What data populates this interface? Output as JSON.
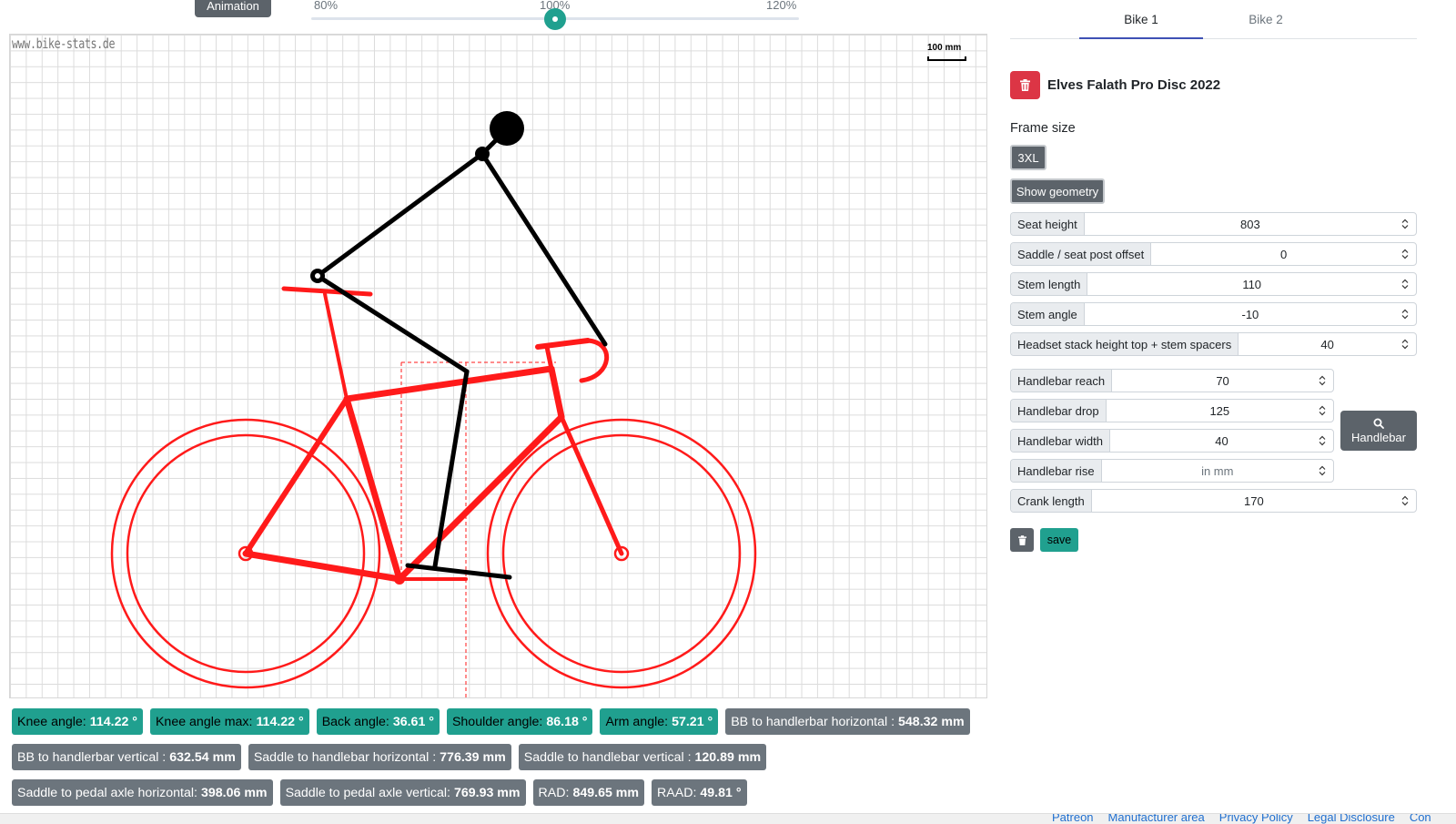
{
  "toolbar": {
    "animation_label": "Animation",
    "slider_min_label": "80%",
    "slider_value_label": "100%",
    "slider_max_label": "120%",
    "slider_value": 100
  },
  "canvas": {
    "watermark": "www.bike-stats.de",
    "scale_label": "100 mm"
  },
  "measurements": [
    [
      {
        "label": "Knee angle:",
        "value": "114.22 °",
        "color": "teal"
      },
      {
        "label": "Knee angle max:",
        "value": "114.22 °",
        "color": "teal"
      },
      {
        "label": "Back angle:",
        "value": "36.61 °",
        "color": "teal"
      },
      {
        "label": "Shoulder angle:",
        "value": "86.18 °",
        "color": "teal"
      },
      {
        "label": "Arm angle:",
        "value": "57.21 °",
        "color": "teal"
      },
      {
        "label": "BB to handlerbar horizontal :",
        "value": "548.32 mm",
        "color": "gray"
      }
    ],
    [
      {
        "label": "BB to handlerbar vertical :",
        "value": "632.54 mm",
        "color": "gray"
      },
      {
        "label": "Saddle to handlebar horizontal :",
        "value": "776.39 mm",
        "color": "gray"
      },
      {
        "label": "Saddle to handlebar vertical :",
        "value": "120.89 mm",
        "color": "gray"
      }
    ],
    [
      {
        "label": "Saddle to pedal axle horizontal:",
        "value": "398.06 mm",
        "color": "gray"
      },
      {
        "label": "Saddle to pedal axle vertical:",
        "value": "769.93 mm",
        "color": "gray"
      },
      {
        "label": "RAD:",
        "value": "849.65 mm",
        "color": "gray"
      },
      {
        "label": "RAAD:",
        "value": "49.81 °",
        "color": "gray"
      }
    ]
  ],
  "tabs": [
    {
      "label": "Bike 1",
      "active": true
    },
    {
      "label": "Bike 2",
      "active": false
    }
  ],
  "bike": {
    "name": "Elves Falath Pro Disc 2022",
    "frame_size_label": "Frame size",
    "frame_size": "3XL",
    "show_geometry_label": "Show geometry"
  },
  "fields": {
    "seat_height": {
      "label": "Seat height",
      "value": "803"
    },
    "saddle_offset": {
      "label": "Saddle / seat post offset",
      "value": "0"
    },
    "stem_length": {
      "label": "Stem length",
      "value": "110"
    },
    "stem_angle": {
      "label": "Stem angle",
      "value": "-10"
    },
    "headset_stack": {
      "label": "Headset stack height top + stem spacers",
      "value": "40"
    },
    "handlebar_reach": {
      "label": "Handlebar reach",
      "value": "70"
    },
    "handlebar_drop": {
      "label": "Handlebar drop",
      "value": "125"
    },
    "handlebar_width": {
      "label": "Handlebar width",
      "value": "40"
    },
    "handlebar_rise": {
      "label": "Handlebar rise",
      "value": "",
      "placeholder": "in mm"
    },
    "crank_length": {
      "label": "Crank length",
      "value": "170"
    }
  },
  "handlebar_button_label": "Handlebar",
  "save_label": "save",
  "footer": [
    "Patreon",
    "Manufacturer area",
    "Privacy Policy",
    "Legal Disclosure",
    "Con"
  ],
  "colors": {
    "accent": "#20a08f",
    "secondary": "#6c757d",
    "danger": "#dc3545",
    "bike": "#ff1a1a",
    "tab_underline": "#3f51b5"
  }
}
